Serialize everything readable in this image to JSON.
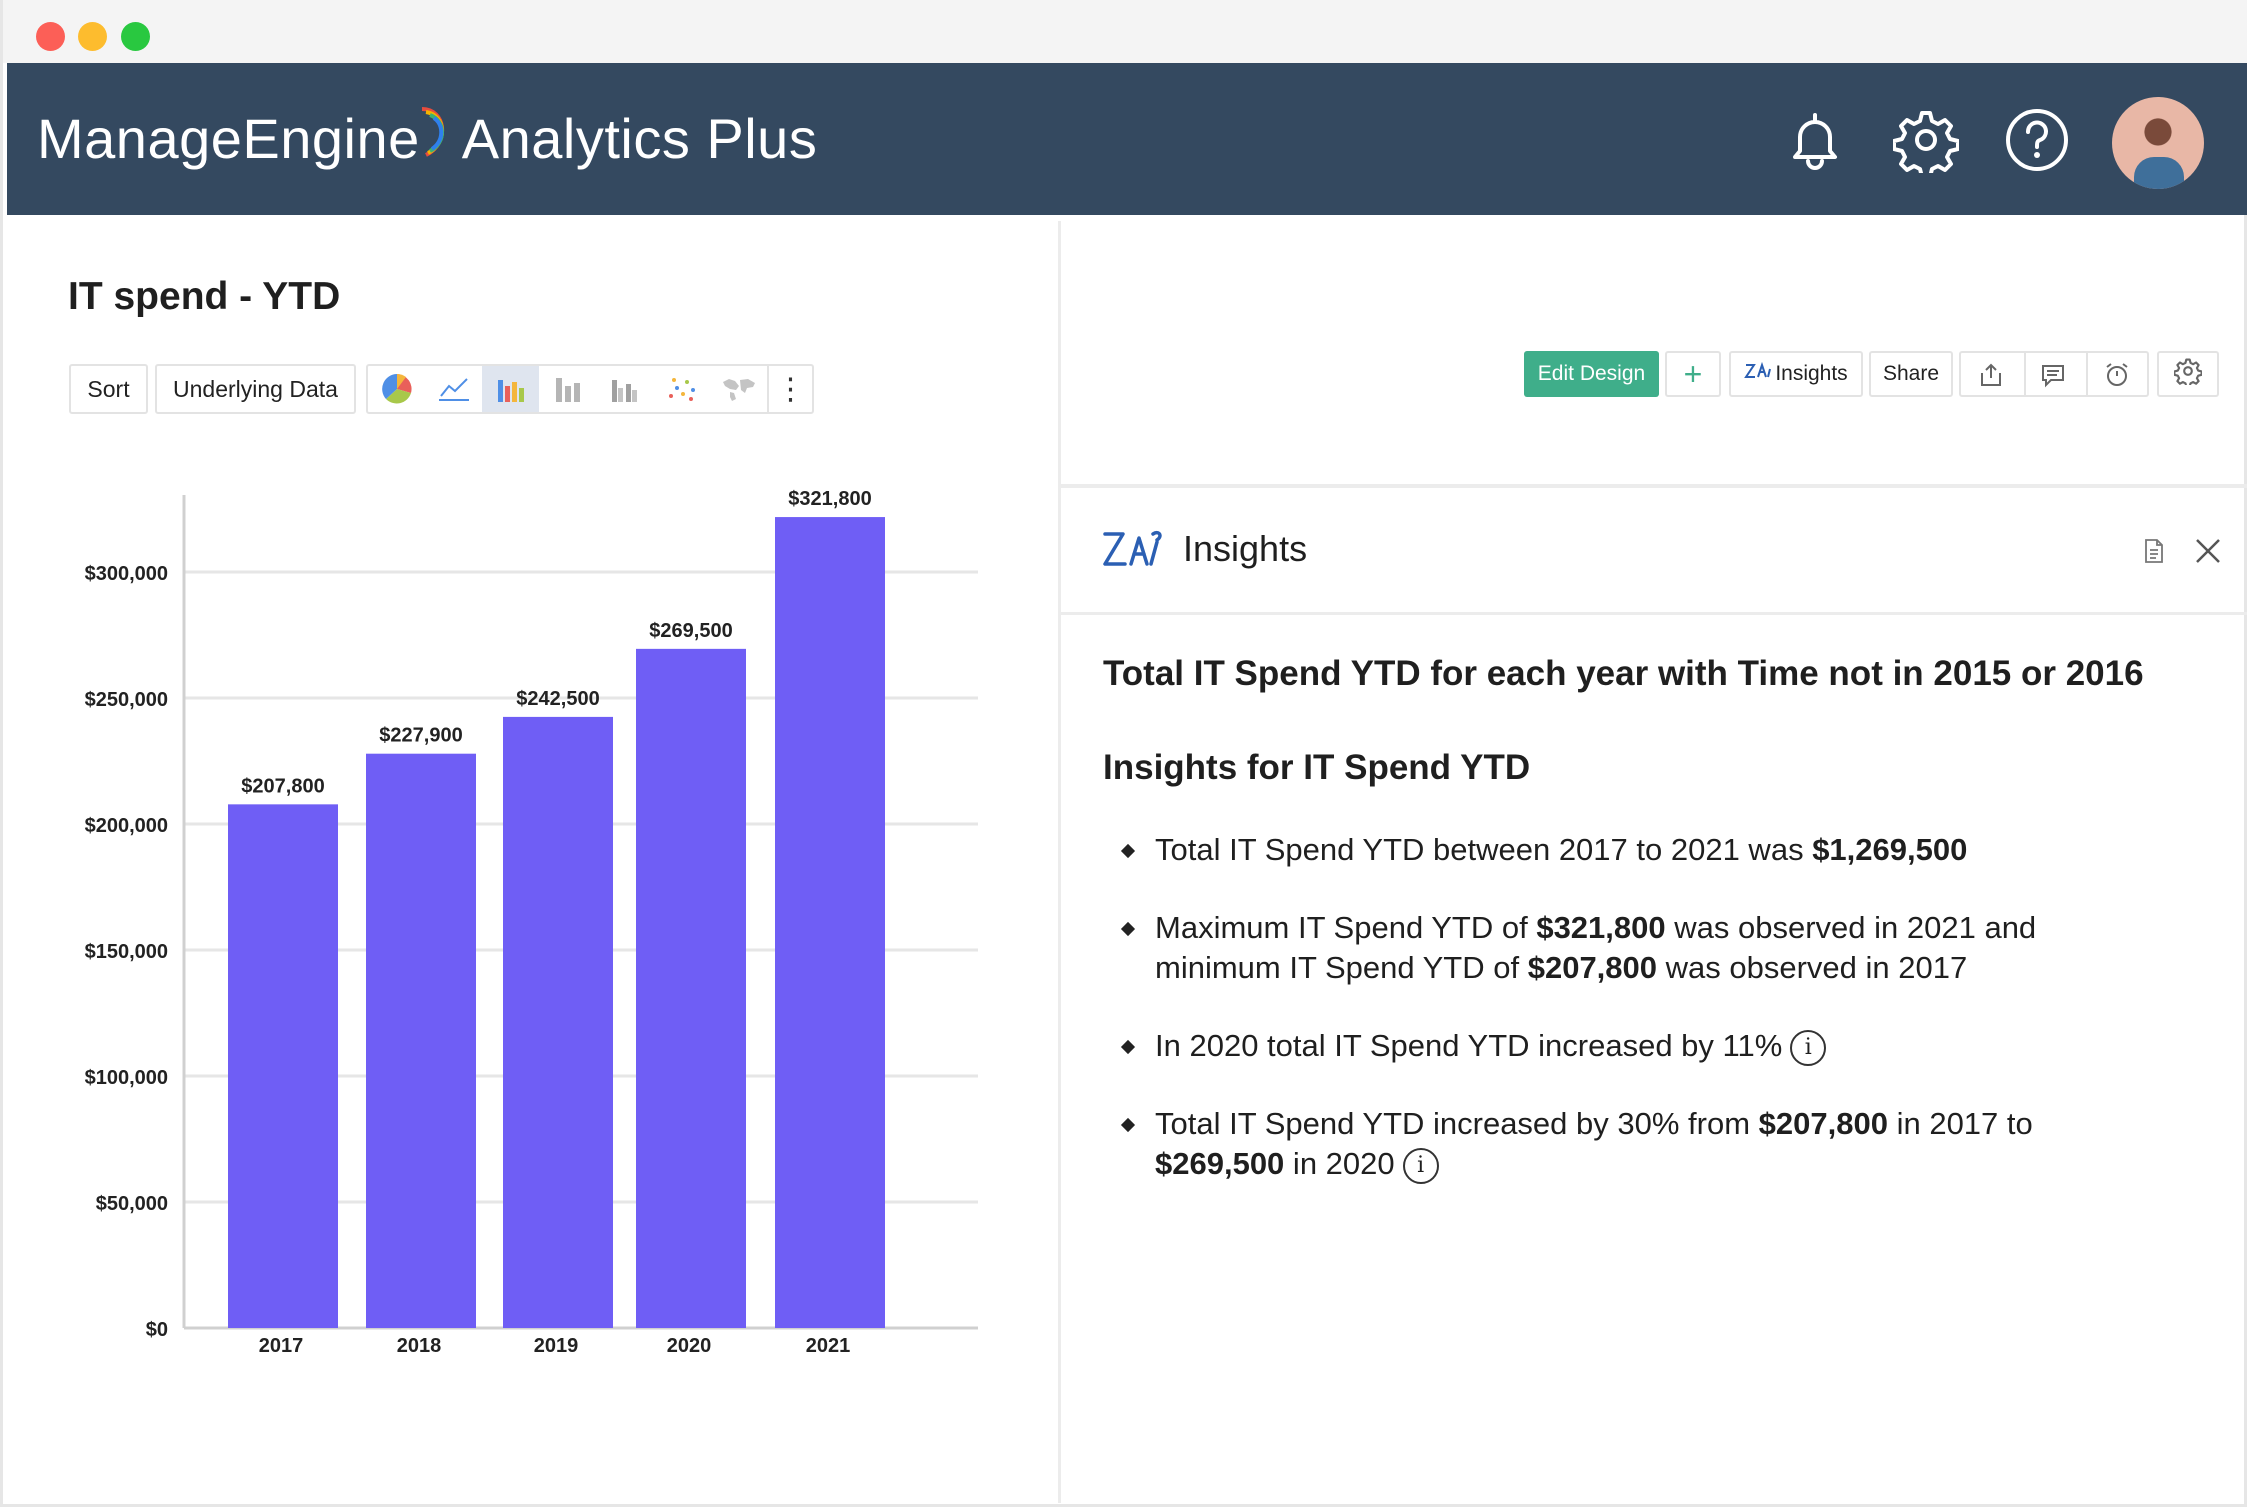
{
  "app": {
    "brand_part1": "ManageEngine",
    "brand_part2": "Analytics Plus"
  },
  "header_icons": [
    "bell-icon",
    "gear-icon",
    "help-icon",
    "avatar"
  ],
  "report": {
    "title": "IT spend - YTD",
    "buttons": {
      "sort": "Sort",
      "underlying_data": "Underlying Data"
    },
    "chart_type_icons": [
      "pie-chart-icon",
      "line-chart-icon",
      "bar-chart-icon",
      "stacked-bar-icon",
      "grouped-bar-icon",
      "scatter-icon",
      "map-icon",
      "more-options-icon"
    ]
  },
  "toolbar": {
    "edit_design": "Edit Design",
    "add": "+",
    "insights": "Insights",
    "share": "Share"
  },
  "insights": {
    "title": "Insights",
    "heading1": "Total IT Spend YTD for each year with Time not in 2015 or 2016",
    "heading2": "Insights for IT Spend YTD",
    "items": [
      {
        "pre": "Total IT Spend YTD between 2017 to 2021 was ",
        "b1": "$1,269,500",
        "mid": "",
        "b2": "",
        "post": ""
      },
      {
        "pre": "Maximum IT Spend YTD of ",
        "b1": "$321,800",
        "mid": " was observed in 2021 and minimum IT Spend YTD of ",
        "b2": "$207,800",
        "post": " was observed in 2017"
      },
      {
        "pre": "In 2020 total IT Spend YTD increased by 11%",
        "b1": "",
        "mid": "",
        "b2": "",
        "post": ""
      },
      {
        "pre": "Total IT Spend YTD increased by 30% from  ",
        "b1": "$207,800",
        "mid": " in 2017 to ",
        "b2": "$269,500",
        "post": " in 2020"
      }
    ],
    "info_glyph": "i"
  },
  "colors": {
    "header_bg": "#344960",
    "bar": "#6f5ef5",
    "edit_design_bg": "#3fae8a"
  },
  "chart_data": {
    "type": "bar",
    "title": "IT spend - YTD",
    "categories": [
      "2017",
      "2018",
      "2019",
      "2020",
      "2021"
    ],
    "values": [
      207800,
      227900,
      242500,
      269500,
      321800
    ],
    "data_labels": [
      "$207,800",
      "$227,900",
      "$242,500",
      "$269,500",
      "$321,800"
    ],
    "y_ticks": [
      0,
      50000,
      100000,
      150000,
      200000,
      250000,
      300000
    ],
    "y_tick_labels": [
      "$0",
      "$50,000",
      "$100,000",
      "$150,000",
      "$200,000",
      "$250,000",
      "$300,000"
    ],
    "ylim": [
      0,
      330000
    ],
    "grid": true,
    "xlabel": "",
    "ylabel": ""
  }
}
